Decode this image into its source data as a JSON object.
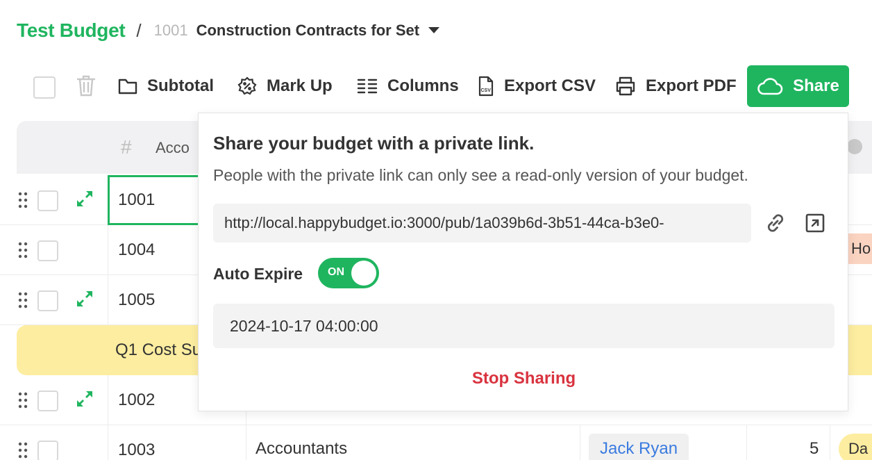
{
  "breadcrumb": {
    "title": "Test Budget",
    "separator": "/",
    "account_number": "1001",
    "account_name": "Construction Contracts for Set"
  },
  "toolbar": {
    "subtotal_label": "Subtotal",
    "markup_label": "Mark Up",
    "columns_label": "Columns",
    "export_csv_label": "Export CSV",
    "export_pdf_label": "Export PDF",
    "share_label": "Share",
    "csv_icon_text": "CSV"
  },
  "table": {
    "header": {
      "hash": "#",
      "account": "Acco"
    },
    "rows": [
      {
        "number": "1001"
      },
      {
        "number": "1004",
        "tag": "Ho"
      },
      {
        "number": "1005"
      },
      {
        "number": "1002"
      },
      {
        "number": "1003",
        "description": "Accountants",
        "contact": "Jack Ryan",
        "quantity": "5",
        "tag": "Da"
      }
    ],
    "subtotal_label": "Q1 Cost Su"
  },
  "share_popover": {
    "title": "Share your budget with a private link.",
    "description": "People with the private link can only see a read-only version of your budget.",
    "link": "http://local.happybudget.io:3000/pub/1a039b6d-3b51-44ca-b3e0-",
    "auto_expire_label": "Auto Expire",
    "toggle_text": "ON",
    "expire_datetime": "2024-10-17 04:00:00",
    "stop_sharing_label": "Stop Sharing"
  },
  "colors": {
    "accent": "#1fb55f",
    "danger": "#d9333f",
    "link": "#3b7be0",
    "subtotal_bg": "#fdeda0"
  }
}
